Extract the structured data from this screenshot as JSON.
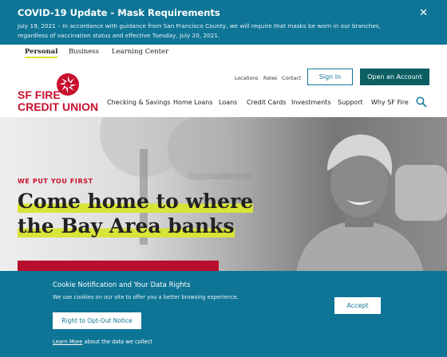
{
  "alert": {
    "title": "COVID-19 Update - Mask Requirements",
    "body": "July 19, 2021 – In accordance with guidance from San Francisco County, we will require that masks be worn in our branches, regardless of vaccination status and effective Tuesday, July 20, 2021.",
    "close_label": "✕"
  },
  "segments": [
    "Personal",
    "Business",
    "Learning Center"
  ],
  "logo": {
    "line1": "SF FIRE",
    "line2": "CREDIT UNION"
  },
  "utility_links": [
    "Locations",
    "Rates",
    "Contact"
  ],
  "buttons": {
    "sign_in": "Sign In",
    "open_account": "Open an Account"
  },
  "nav": [
    "Checking & Savings",
    "Home Loans",
    "Loans",
    "Credit Cards",
    "Investments",
    "Support",
    "Why SF Fire"
  ],
  "hero": {
    "eyebrow": "WE PUT YOU FIRST",
    "headline_line1": "Come home to where",
    "headline_line2": "the Bay Area banks"
  },
  "cookie": {
    "title": "Cookie Notification and Your Data Rights",
    "text": "We use cookies on our site to offer you a better browsing experience.",
    "optout_label": "Right to Opt-Out Notice",
    "learn_more_link": "Learn More",
    "learn_more_rest": " about the data we collect",
    "accept_label": "Accept"
  },
  "colors": {
    "brand_teal": "#0f7596",
    "brand_red": "#c8102e",
    "highlight": "#d8e437",
    "dark_teal": "#0b5e62"
  },
  "icons": {
    "close": "close-icon",
    "search": "search-icon",
    "logo": "fire-wheel-icon"
  }
}
